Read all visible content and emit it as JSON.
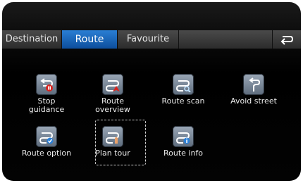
{
  "tabs": [
    {
      "label": "Destination",
      "active": false
    },
    {
      "label": "Route",
      "active": true
    },
    {
      "label": "Favourite",
      "active": false
    }
  ],
  "back_icon": "return-arrow-icon",
  "menu": [
    {
      "label": "Stop\nguidance",
      "icon": "stop-guidance-icon"
    },
    {
      "label": "Route\noverview",
      "icon": "route-overview-icon"
    },
    {
      "label": "Route scan",
      "icon": "route-scan-icon"
    },
    {
      "label": "Avoid street",
      "icon": "avoid-street-icon"
    },
    {
      "label": "Route option",
      "icon": "route-option-icon"
    },
    {
      "label": "Plan tour",
      "icon": "plan-tour-icon",
      "focused": true
    },
    {
      "label": "Route info",
      "icon": "route-info-icon"
    }
  ],
  "colors": {
    "active_tab": "#1e6fc4",
    "background": "#000000",
    "icon_tile": "#7d8a99"
  }
}
